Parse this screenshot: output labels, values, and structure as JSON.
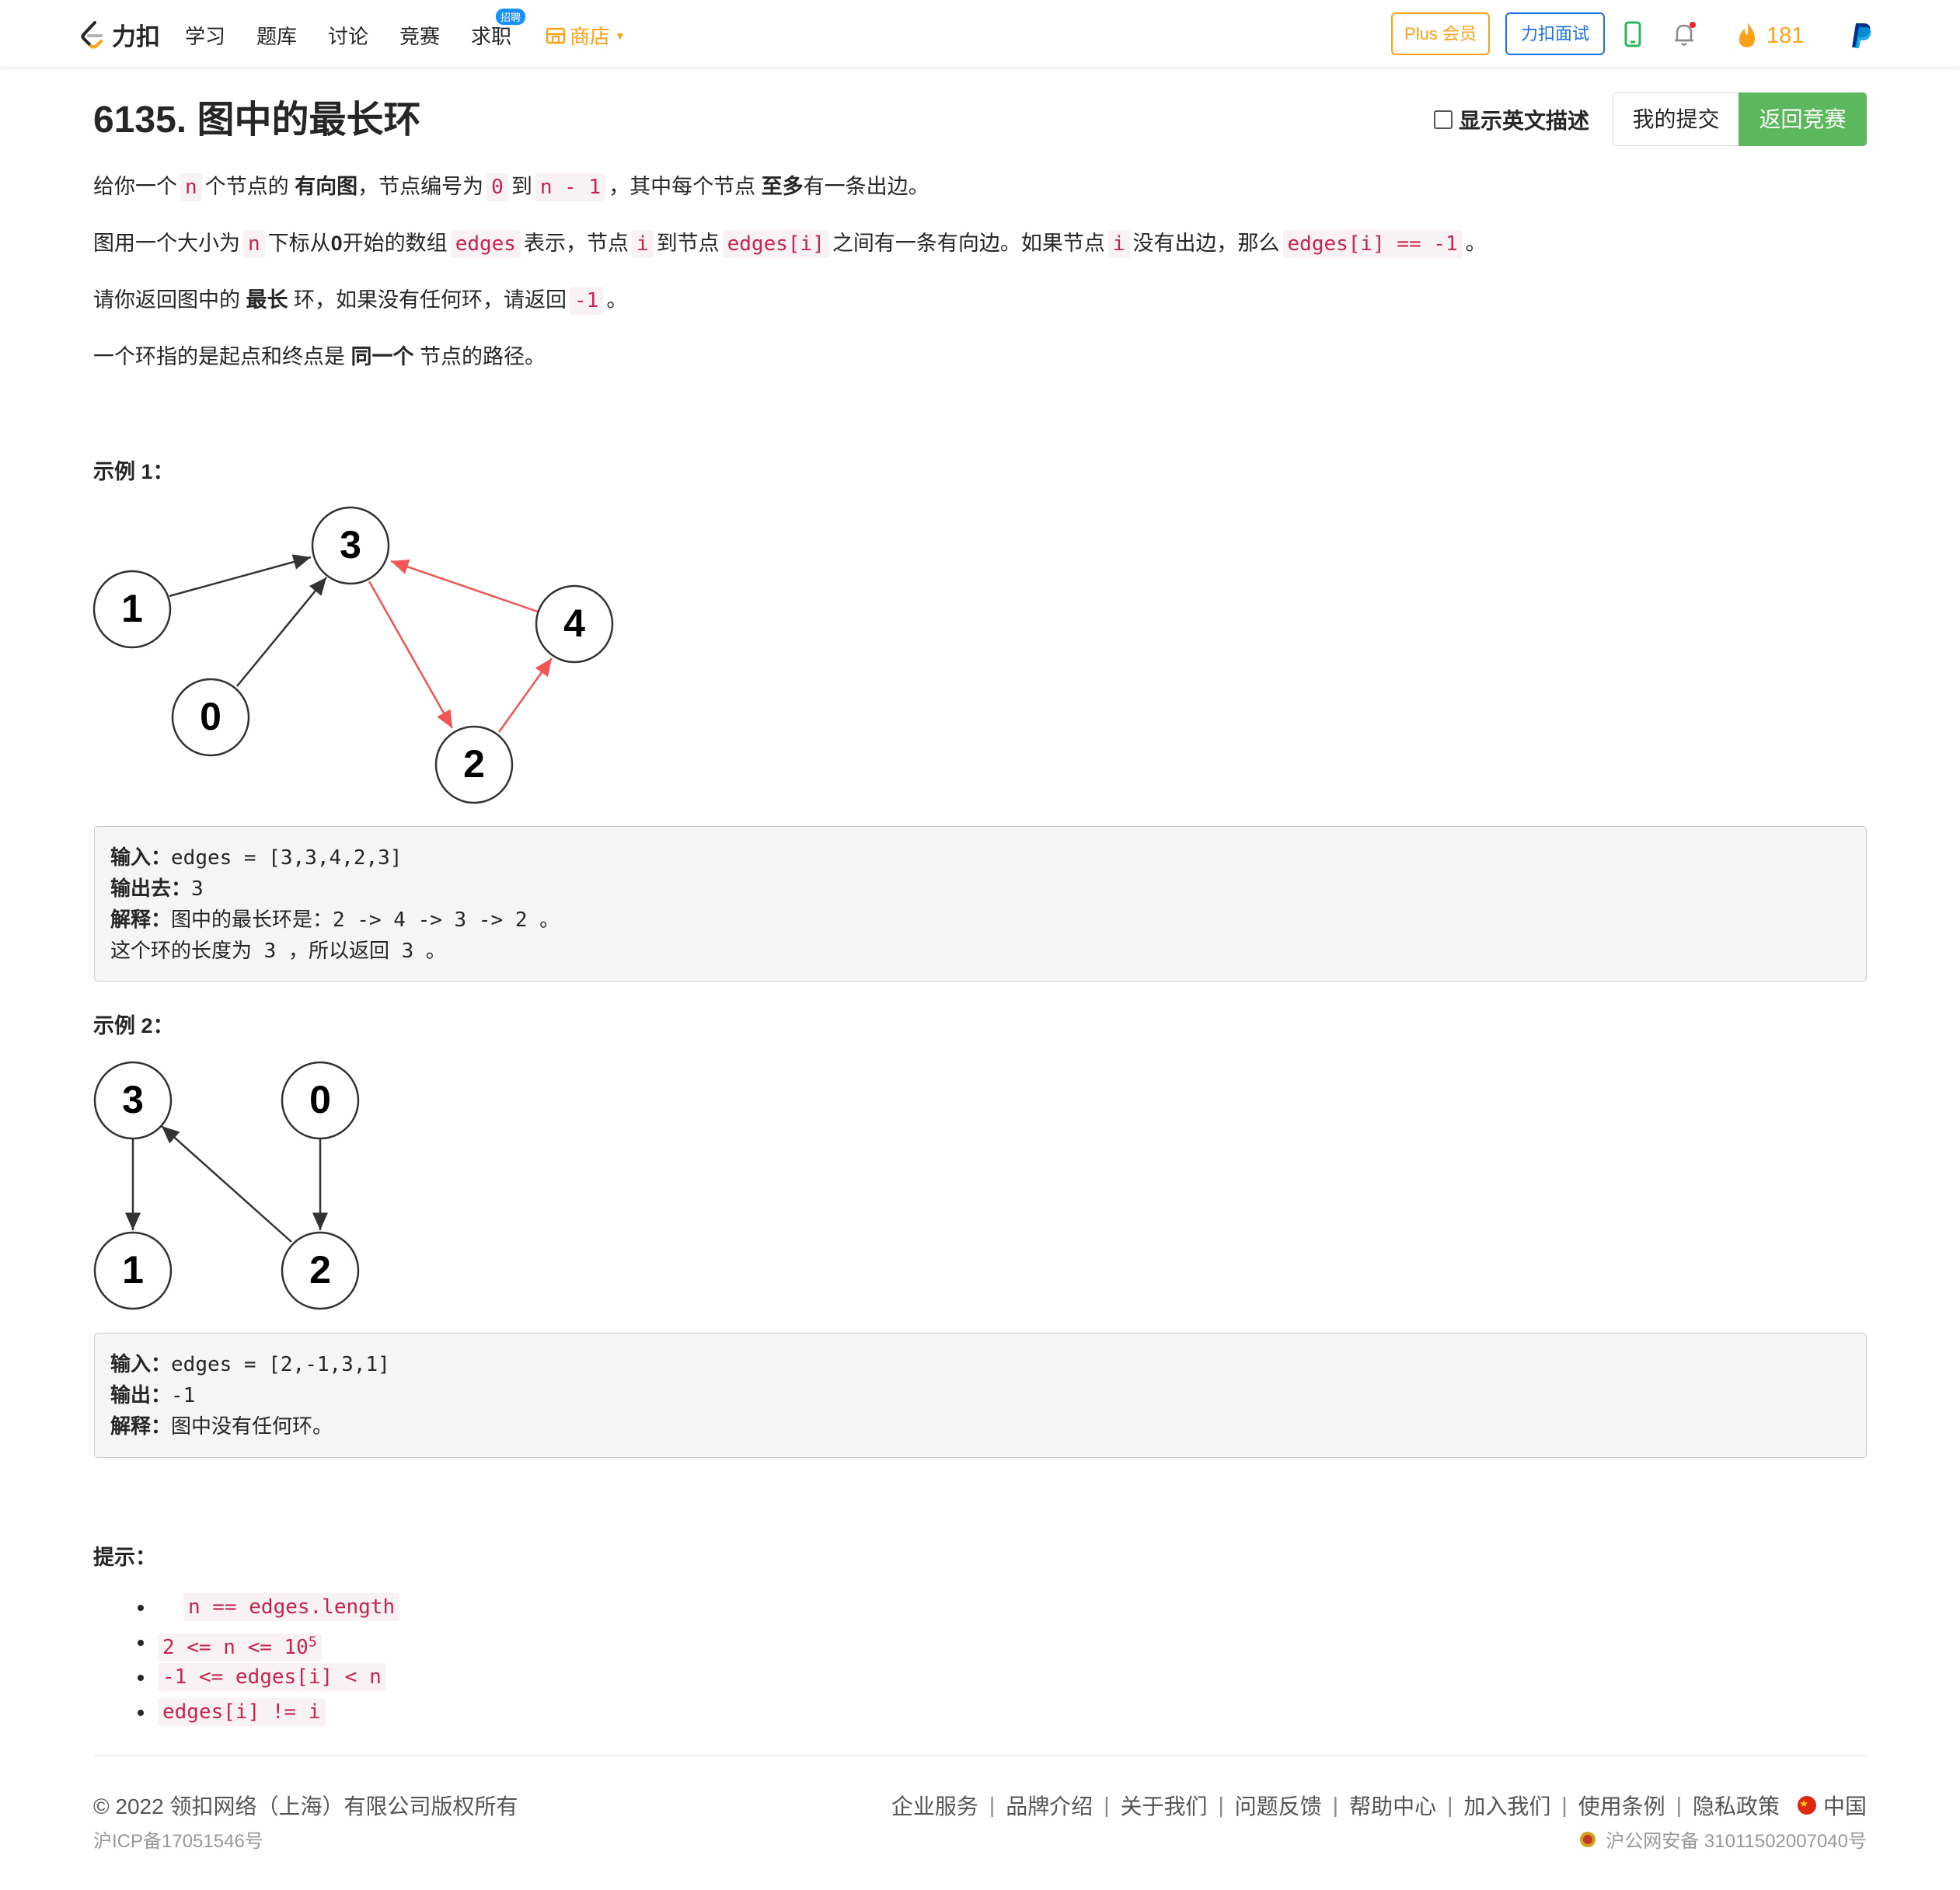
{
  "nav": {
    "logo_text": "力扣",
    "items": [
      "学习",
      "题库",
      "讨论",
      "竞赛",
      "求职"
    ],
    "hiring_badge": "招聘",
    "store": "商店",
    "plus": "Plus 会员",
    "interview": "力扣面试",
    "streak": "181",
    "icons": [
      "leetcode-logo-icon",
      "store-icon",
      "phone-icon",
      "bell-icon",
      "flame-icon",
      "paypal-icon"
    ],
    "colors": {
      "accent": "#ffa116",
      "blue": "#1a73e8",
      "green": "#5cb85c"
    }
  },
  "header": {
    "title": "6135. 图中的最长环",
    "show_english": "显示英文描述",
    "my_submissions": "我的提交",
    "back_to_contest": "返回竞赛"
  },
  "description": {
    "p1": [
      "给你一个",
      "n",
      "个节点的",
      "有向图",
      "，节点编号为",
      "0",
      "到",
      "n - 1",
      "，其中每个节点",
      "至多",
      "有一条出边。"
    ],
    "p2": [
      "图用一个大小为",
      "n",
      "下标从",
      "0",
      "开始的数组",
      "edges",
      "表示，节点",
      "i",
      "到节点",
      "edges[i]",
      "之间有一条有向边。如果节点",
      "i",
      "没有出边，那么",
      "edges[i] == -1",
      "。"
    ],
    "p3": [
      "请你返回图中的",
      "最长",
      "环，如果没有任何环，请返回",
      "-1",
      "。"
    ],
    "p4": [
      "一个环指的是起点和终点是",
      "同一个",
      "节点的路径。"
    ]
  },
  "example1": {
    "heading": "示例 1：",
    "graph": {
      "nodes": [
        "3",
        "1",
        "4",
        "0",
        "2"
      ],
      "edges_black": [
        "1→3",
        "0→3"
      ],
      "edges_red": [
        "3→2",
        "2→4",
        "4→3"
      ]
    },
    "input_label": "输入：",
    "input": "edges = [3,3,4,2,3]",
    "output_label": "输出去：",
    "output": "3",
    "explain_label": "解释：",
    "explain": "图中的最长环是：2 -> 4 -> 3 -> 2 。",
    "explain2": "这个环的长度为 3 ，所以返回 3 。"
  },
  "example2": {
    "heading": "示例 2：",
    "graph": {
      "nodes": [
        "3",
        "0",
        "1",
        "2"
      ],
      "edges": [
        "3→1",
        "2→3",
        "0→2"
      ]
    },
    "input_label": "输入：",
    "input": "edges = [2,-1,3,1]",
    "output_label": "输出：",
    "output": "-1",
    "explain_label": "解释：",
    "explain": "图中没有任何环。"
  },
  "constraints": {
    "heading": "提示：",
    "items": [
      "n == edges.length",
      "2 <= n <= 10",
      "-1 <= edges[i] < n",
      "edges[i] != i"
    ],
    "superscript": "5"
  },
  "footer": {
    "copyright": "© 2022 领扣网络（上海）有限公司版权所有",
    "icp": "沪ICP备17051546号",
    "links": [
      "企业服务",
      "品牌介绍",
      "关于我们",
      "问题反馈",
      "帮助中心",
      "加入我们",
      "使用条例",
      "隐私政策"
    ],
    "region": "中国",
    "police": "沪公网安备 31011502007040号"
  }
}
